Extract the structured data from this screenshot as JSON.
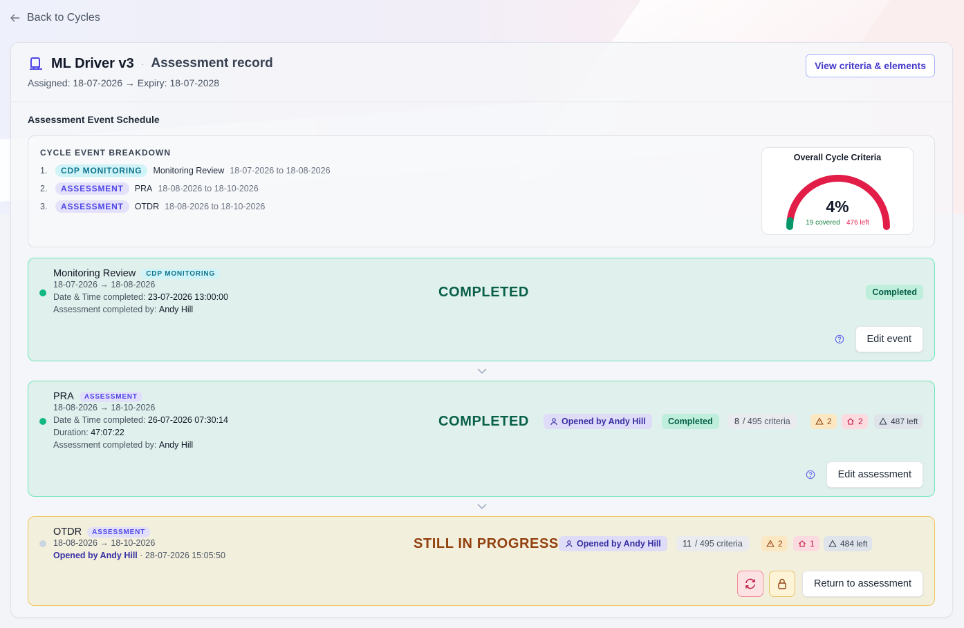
{
  "nav": {
    "back_label": "Back to Cycles"
  },
  "record": {
    "name": "ML Driver v3",
    "separator": "·",
    "subtitle": "Assessment record",
    "assigned": "Assigned: 18-07-2026 → Expiry: 18-07-2028",
    "view_criteria_label": "View criteria & elements"
  },
  "schedule": {
    "title": "Assessment Event Schedule",
    "breakdown_title": "CYCLE EVENT BREAKDOWN",
    "rows": [
      {
        "num": "1.",
        "tag": "CDP MONITORING",
        "name": "Monitoring Review",
        "dates": "18-07-2026 to 18-08-2026"
      },
      {
        "num": "2.",
        "tag": "ASSESSMENT",
        "name": "PRA",
        "dates": "18-08-2026 to 18-10-2026"
      },
      {
        "num": "3.",
        "tag": "ASSESSMENT",
        "name": "OTDR",
        "dates": "18-08-2026 to 18-10-2026"
      }
    ]
  },
  "gauge": {
    "title": "Overall Cycle Criteria",
    "percent_label": "4%",
    "percent": 0.04,
    "covered": "19 covered",
    "sep": "·",
    "left": "476 left",
    "colors": {
      "covered": "#059669",
      "remaining": "#e11d48"
    }
  },
  "events": {
    "monitoring": {
      "name": "Monitoring Review",
      "tag": "CDP MONITORING",
      "dates": "18-07-2026 → 18-08-2026",
      "completed_label": "Date & Time completed:",
      "completed_value": "23-07-2026 13:00:00",
      "by_label": "Assessment completed by:",
      "by_value": "Andy Hill",
      "status": "COMPLETED",
      "badge": "Completed",
      "button": "Edit event"
    },
    "pra": {
      "name": "PRA",
      "tag": "ASSESSMENT",
      "dates": "18-08-2026 → 18-10-2026",
      "completed_label": "Date & Time completed:",
      "completed_value": "26-07-2026 07:30:14",
      "duration_label": "Duration:",
      "duration_value": "47:07:22",
      "by_label": "Assessment completed by:",
      "by_value": "Andy Hill",
      "status": "COMPLETED",
      "opened_by": "Opened by Andy Hill",
      "badge": "Completed",
      "criteria_count": "8",
      "criteria_rest": " / 495 criteria",
      "warn_count": "2",
      "home_count": "2",
      "left_label": "487 left",
      "button": "Edit assessment"
    },
    "otdr": {
      "name": "OTDR",
      "tag": "ASSESSMENT",
      "dates": "18-08-2026 → 18-10-2026",
      "opened_line": "Opened by Andy Hill",
      "opened_ts": " · 28-07-2026 15:05:50",
      "status": "STILL IN PROGRESS",
      "opened_by": "Opened by Andy Hill",
      "criteria_count": "11",
      "criteria_rest": " / 495 criteria",
      "warn_count": "2",
      "home_count": "1",
      "left_label": "484 left",
      "button": "Return to assessment"
    }
  }
}
